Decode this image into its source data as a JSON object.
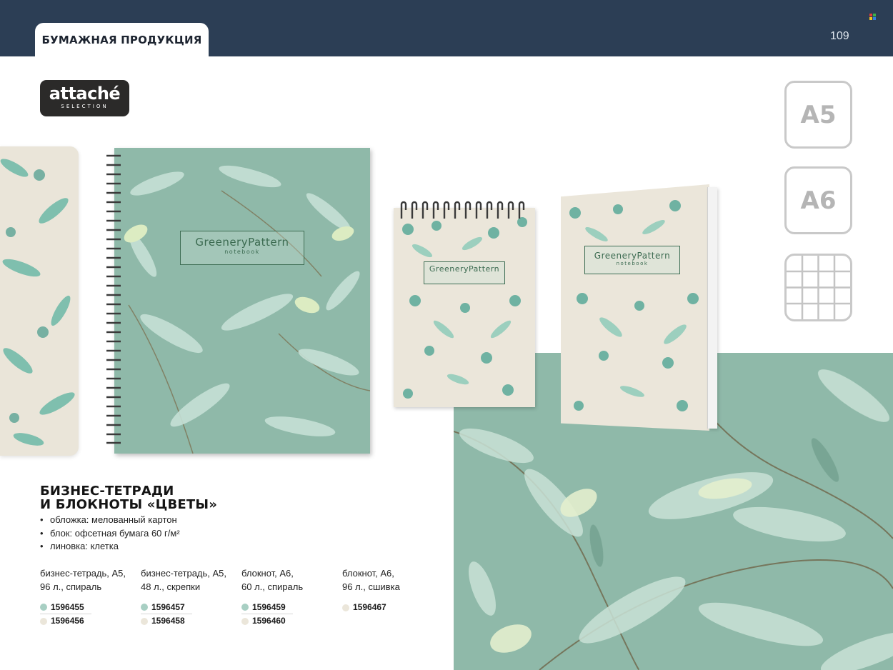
{
  "header": {
    "section": "БУМАЖНАЯ ПРОДУКЦИЯ",
    "page_number": "109"
  },
  "brand": {
    "name": "attaché",
    "sub": "SELECTION"
  },
  "formats": [
    "A5",
    "A6"
  ],
  "format_icons": [
    "grid-ruling-icon"
  ],
  "product_label": {
    "title": "GreeneryPattern",
    "sub": "notebook"
  },
  "product": {
    "title_line1": "БИЗНЕС-ТЕТРАДИ",
    "title_line2": "И БЛОКНОТЫ «ЦВЕТЫ»",
    "features": [
      "обложка: мелованный картон",
      "блок: офсетная бумага 60 г/м²",
      "линовка: клетка"
    ]
  },
  "variants": [
    {
      "line1": "бизнес-тетрадь, А5,",
      "line2": "96 л., спираль",
      "codes": [
        "1596455",
        "1596456"
      ]
    },
    {
      "line1": "бизнес-тетрадь, А5,",
      "line2": "48 л., скрепки",
      "codes": [
        "1596457",
        "1596458"
      ]
    },
    {
      "line1": "блокнот, А6,",
      "line2": "60 л., спираль",
      "codes": [
        "1596459",
        "1596460"
      ]
    },
    {
      "line1": "блокнот, А6,",
      "line2": "96 л., сшивка",
      "codes": [
        "1596467"
      ]
    }
  ],
  "colors": {
    "header_bg": "#2c3e55",
    "mint_cover": "#a8cfc3",
    "cream_cover": "#ebe6da",
    "pattern_bg": "#8fb9a9"
  }
}
